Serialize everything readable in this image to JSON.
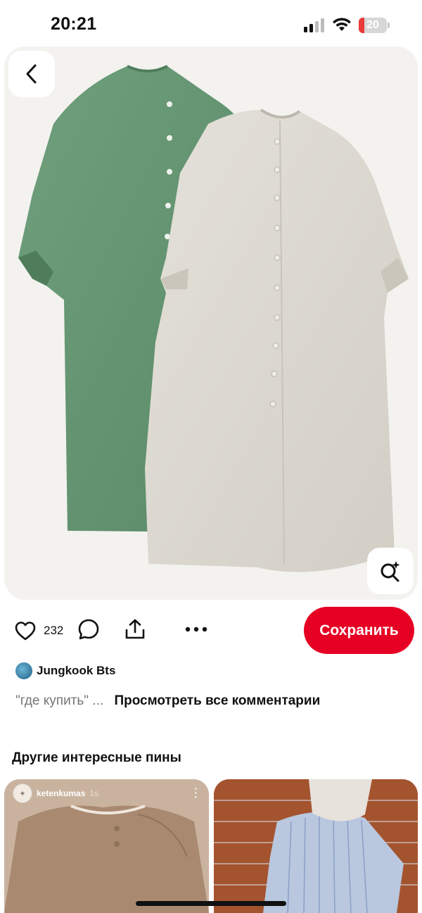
{
  "status_bar": {
    "time": "20:21",
    "battery_level": "20",
    "battery_fraction": 0.2,
    "battery_color": "#ea3a3a",
    "icons": [
      "signal-icon",
      "wifi-icon",
      "battery-icon"
    ]
  },
  "pin": {
    "image_icon_back": "chevron-left-icon",
    "image_icon_lens": "visual-search-icon"
  },
  "actions": {
    "like_count": "232",
    "save_label": "Сохранить",
    "save_color": "#e60023"
  },
  "comments": {
    "author": "Jungkook Bts",
    "preview": "\"где купить\" ...",
    "view_all": "Просмотреть все комментарии"
  },
  "more_pins": {
    "title": "Другие интересные пины",
    "items": [
      {
        "user": "ketenkumas",
        "age": "1s"
      },
      {
        "user": "",
        "age": ""
      }
    ]
  }
}
